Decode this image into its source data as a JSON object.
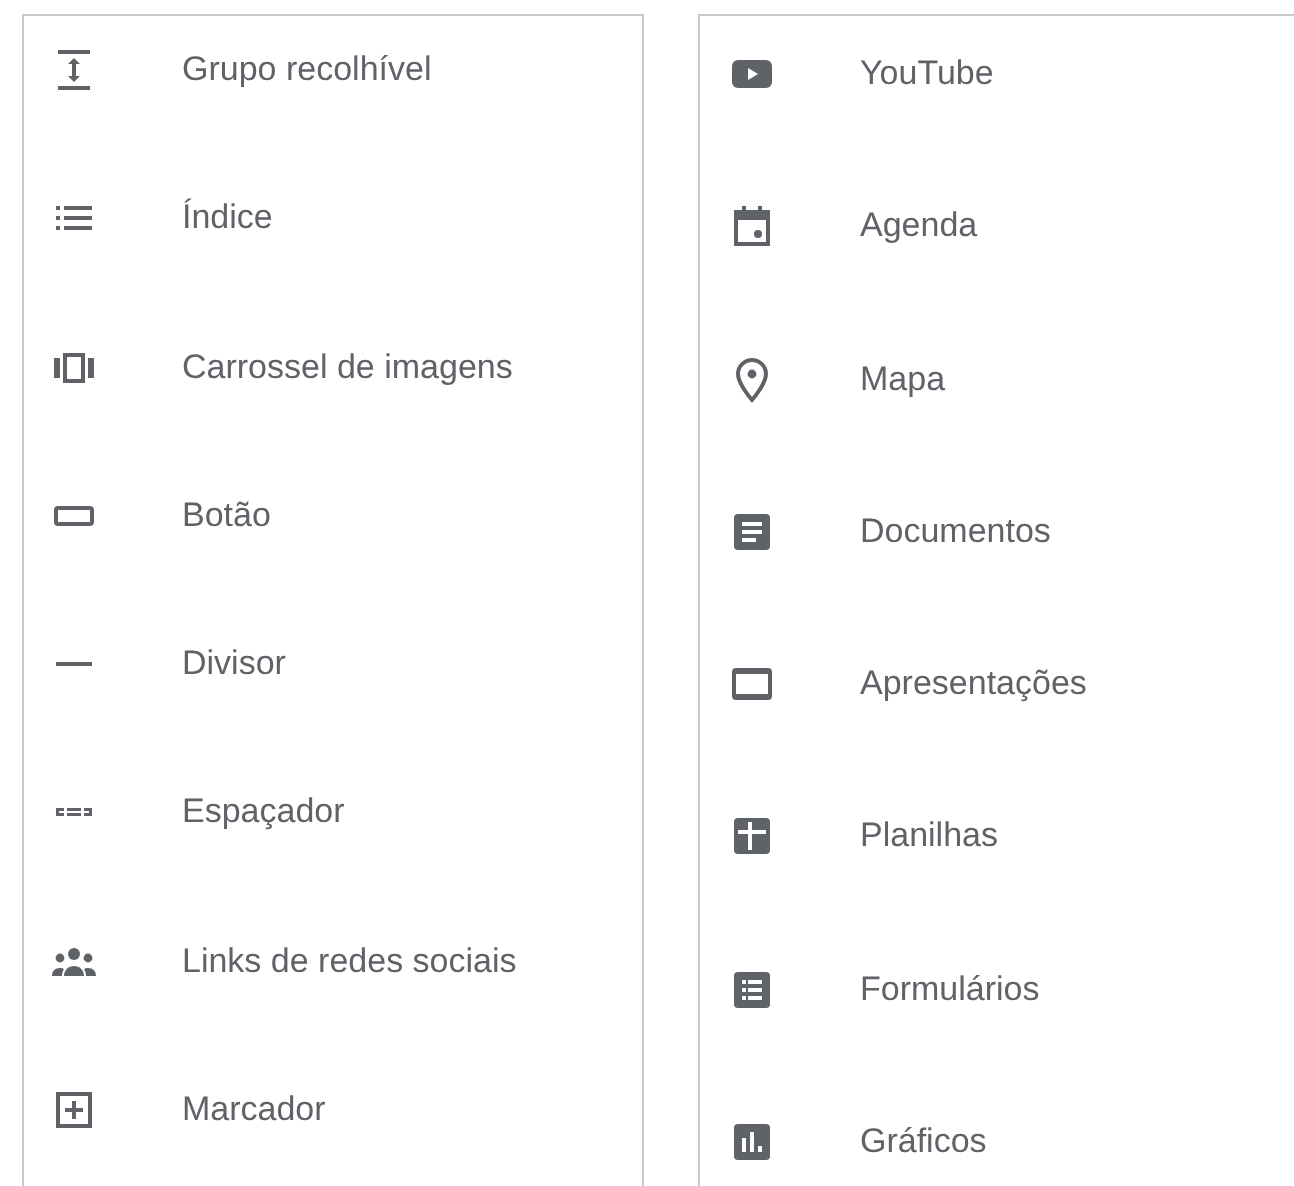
{
  "panels": [
    {
      "items": [
        {
          "label": "Grupo recolhível"
        },
        {
          "label": "Índice"
        },
        {
          "label": "Carrossel de imagens"
        },
        {
          "label": "Botão"
        },
        {
          "label": "Divisor"
        },
        {
          "label": "Espaçador"
        },
        {
          "label": "Links de redes sociais"
        },
        {
          "label": "Marcador"
        }
      ]
    },
    {
      "items": [
        {
          "label": "YouTube"
        },
        {
          "label": "Agenda"
        },
        {
          "label": "Mapa"
        },
        {
          "label": "Documentos"
        },
        {
          "label": "Apresentações"
        },
        {
          "label": "Planilhas"
        },
        {
          "label": "Formulários"
        },
        {
          "label": "Gráficos"
        }
      ]
    }
  ]
}
